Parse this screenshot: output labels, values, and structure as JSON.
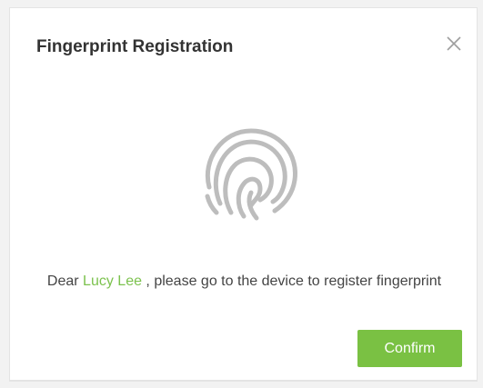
{
  "dialog": {
    "title": "Fingerprint Registration",
    "close_icon": "close-icon",
    "fingerprint_icon": "fingerprint-icon",
    "message": {
      "prefix": "Dear ",
      "name": "Lucy Lee",
      "suffix": " , please go to the device to register fingerprint"
    },
    "confirm_label": "Confirm"
  },
  "colors": {
    "accent_green": "#7ac143",
    "name_green": "#7cc24e",
    "icon_gray": "#bdbdbd"
  }
}
